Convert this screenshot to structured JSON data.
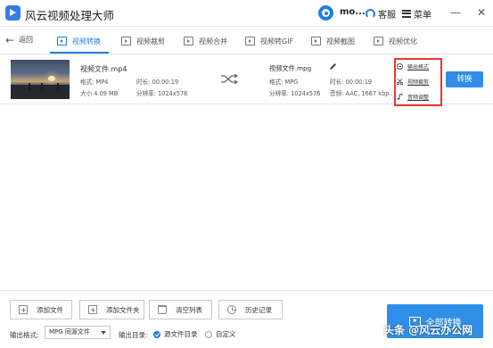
{
  "app": {
    "title": "风云视频处理大师"
  },
  "titlebar": {
    "user_name": "mo...",
    "service_label": "客服",
    "menu_label": "菜单",
    "minimize_glyph": "—",
    "close_glyph": "✕"
  },
  "toolbar": {
    "back_label": "返回",
    "tabs": [
      {
        "label": "视频转换",
        "icon": "video-convert-icon",
        "active": true
      },
      {
        "label": "视频裁剪",
        "icon": "video-cut-icon"
      },
      {
        "label": "视频合并",
        "icon": "video-merge-icon"
      },
      {
        "label": "视频转GIF",
        "icon": "video-gif-icon"
      },
      {
        "label": "视频截图",
        "icon": "video-screenshot-icon"
      },
      {
        "label": "视频优化",
        "icon": "video-optimize-icon"
      }
    ]
  },
  "file": {
    "source": {
      "name": "视频文件.mp4",
      "format": "格式: MP4",
      "duration": "时长: 00:00:19",
      "size": "大小 4.09 MB",
      "resolution": "分辨率: 1024x576"
    },
    "output": {
      "name": "视频文件.mpg",
      "format": "格式: MPG",
      "duration": "时长: 00:00:19",
      "resolution": "分辨率: 1024x576",
      "audio": "音频: AAC, 1667 kbp..."
    },
    "actions": [
      {
        "label": "输出格式",
        "icon": "output-format-icon"
      },
      {
        "label": "视频裁剪",
        "icon": "scissors-icon"
      },
      {
        "label": "音频调整",
        "icon": "music-note-icon"
      }
    ],
    "convert_label": "转换"
  },
  "bottom": {
    "buttons": [
      {
        "label": "添加文件",
        "icon": "add-file-icon"
      },
      {
        "label": "添加文件夹",
        "icon": "add-folder-icon"
      },
      {
        "label": "清空列表",
        "icon": "trash-icon"
      },
      {
        "label": "历史记录",
        "icon": "history-icon"
      }
    ],
    "output_format_label": "输出格式:",
    "output_format_value": "MPG 同源文件",
    "output_dir_label": "输出目录:",
    "dir_options": [
      {
        "label": "源文件目录",
        "selected": true
      },
      {
        "label": "自定义",
        "selected": false
      }
    ],
    "convert_all_label": "全部转换"
  },
  "watermark": "头条 @风云办公网",
  "colors": {
    "accent": "#2f8ee8",
    "highlight_box": "#e53935"
  }
}
